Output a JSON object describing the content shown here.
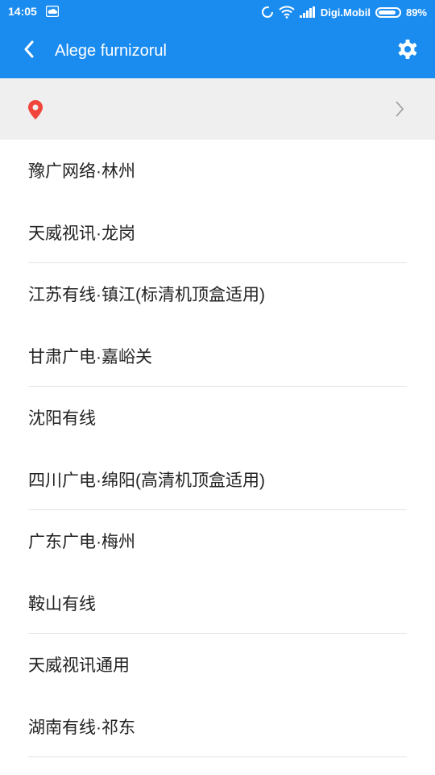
{
  "status_bar": {
    "time": "14:05",
    "carrier": "Digi.Mobil",
    "battery_percent": "89%",
    "battery_level": 0.89,
    "icons": [
      "cloud-icon",
      "sync-icon",
      "wifi-icon",
      "signal-icon",
      "battery-icon"
    ]
  },
  "app_bar": {
    "title": "Alege furnizorul",
    "back_icon": "back-arrow-icon",
    "settings_icon": "gear-icon"
  },
  "location": {
    "text": "",
    "icon": "location-pin-icon",
    "chevron": "chevron-right-icon"
  },
  "providers": [
    {
      "label": "豫广网络·林州"
    },
    {
      "label": "天威视讯·龙岗"
    },
    {
      "label": "江苏有线·镇江(标清机顶盒适用)"
    },
    {
      "label": "甘肃广电·嘉峪关"
    },
    {
      "label": "沈阳有线"
    },
    {
      "label": "四川广电·绵阳(高清机顶盒适用)"
    },
    {
      "label": "广东广电·梅州"
    },
    {
      "label": "鞍山有线"
    },
    {
      "label": "天威视讯通用"
    },
    {
      "label": "湖南有线·祁东"
    }
  ],
  "colors": {
    "accent": "#1a8cf0",
    "location_pin": "#f0453a",
    "location_bar_bg": "#efefef",
    "divider": "#e4e4e4"
  }
}
